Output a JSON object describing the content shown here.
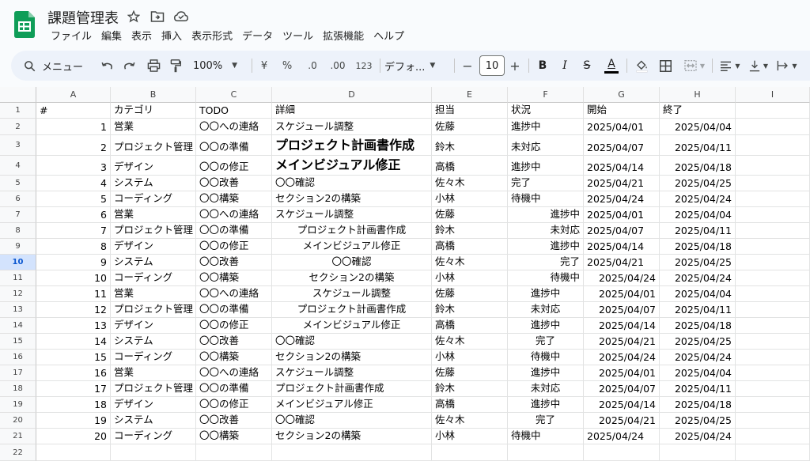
{
  "doc": {
    "title": "課題管理表"
  },
  "menu": [
    "ファイル",
    "編集",
    "表示",
    "挿入",
    "表示形式",
    "データ",
    "ツール",
    "拡張機能",
    "ヘルプ"
  ],
  "toolbar": {
    "search_label": "メニュー",
    "zoom": "100%",
    "currency": "¥",
    "percent": "%",
    "dec_decrease": ".0",
    "dec_increase": ".00",
    "number_format": "123",
    "font": "デフォ...",
    "font_size": "10",
    "minus": "−",
    "plus": "+",
    "bold": "B",
    "italic": "I",
    "strike": "S",
    "textcolor": "A"
  },
  "columns": [
    "A",
    "B",
    "C",
    "D",
    "E",
    "F",
    "G",
    "H",
    "I"
  ],
  "header_row": [
    "#",
    "カテゴリ",
    "TODO",
    "詳細",
    "担当",
    "状況",
    "開始",
    "終了",
    ""
  ],
  "rows": [
    [
      "1",
      "営業",
      "〇〇への連絡",
      "スケジュール調整",
      "佐藤",
      "進捗中",
      "2025/04/01",
      "2025/04/04"
    ],
    [
      "2",
      "プロジェクト管理",
      "〇〇の準備",
      "プロジェクト計画書作成",
      "鈴木",
      "未対応",
      "2025/04/07",
      "2025/04/11"
    ],
    [
      "3",
      "デザイン",
      "〇〇の修正",
      "メインビジュアル修正",
      "高橋",
      "進捗中",
      "2025/04/14",
      "2025/04/18"
    ],
    [
      "4",
      "システム",
      "〇〇改善",
      "〇〇確認",
      "佐々木",
      "完了",
      "2025/04/21",
      "2025/04/25"
    ],
    [
      "5",
      "コーディング",
      "〇〇構築",
      "セクション2の構築",
      "小林",
      "待機中",
      "2025/04/24",
      "2025/04/24"
    ],
    [
      "6",
      "営業",
      "〇〇への連絡",
      "スケジュール調整",
      "佐藤",
      "進捗中",
      "2025/04/01",
      "2025/04/04"
    ],
    [
      "7",
      "プロジェクト管理",
      "〇〇の準備",
      "プロジェクト計画書作成",
      "鈴木",
      "未対応",
      "2025/04/07",
      "2025/04/11"
    ],
    [
      "8",
      "デザイン",
      "〇〇の修正",
      "メインビジュアル修正",
      "高橋",
      "進捗中",
      "2025/04/14",
      "2025/04/18"
    ],
    [
      "9",
      "システム",
      "〇〇改善",
      "〇〇確認",
      "佐々木",
      "完了",
      "2025/04/21",
      "2025/04/25"
    ],
    [
      "10",
      "コーディング",
      "〇〇構築",
      "セクション2の構築",
      "小林",
      "待機中",
      "2025/04/24",
      "2025/04/24"
    ],
    [
      "11",
      "営業",
      "〇〇への連絡",
      "スケジュール調整",
      "佐藤",
      "進捗中",
      "2025/04/01",
      "2025/04/04"
    ],
    [
      "12",
      "プロジェクト管理",
      "〇〇の準備",
      "プロジェクト計画書作成",
      "鈴木",
      "未対応",
      "2025/04/07",
      "2025/04/11"
    ],
    [
      "13",
      "デザイン",
      "〇〇の修正",
      "メインビジュアル修正",
      "高橋",
      "進捗中",
      "2025/04/14",
      "2025/04/18"
    ],
    [
      "14",
      "システム",
      "〇〇改善",
      "〇〇確認",
      "佐々木",
      "完了",
      "2025/04/21",
      "2025/04/25"
    ],
    [
      "15",
      "コーディング",
      "〇〇構築",
      "セクション2の構築",
      "小林",
      "待機中",
      "2025/04/24",
      "2025/04/24"
    ],
    [
      "16",
      "営業",
      "〇〇への連絡",
      "スケジュール調整",
      "佐藤",
      "進捗中",
      "2025/04/01",
      "2025/04/04"
    ],
    [
      "17",
      "プロジェクト管理",
      "〇〇の準備",
      "プロジェクト計画書作成",
      "鈴木",
      "未対応",
      "2025/04/07",
      "2025/04/11"
    ],
    [
      "18",
      "デザイン",
      "〇〇の修正",
      "メインビジュアル修正",
      "高橋",
      "進捗中",
      "2025/04/14",
      "2025/04/18"
    ],
    [
      "19",
      "システム",
      "〇〇改善",
      "〇〇確認",
      "佐々木",
      "完了",
      "2025/04/21",
      "2025/04/25"
    ],
    [
      "20",
      "コーディング",
      "〇〇構築",
      "セクション2の構築",
      "小林",
      "待機中",
      "2025/04/24",
      "2025/04/24"
    ],
    [
      "",
      "",
      "",
      "",
      "",
      "",
      "",
      "",
      ""
    ]
  ],
  "row_numbers": [
    "1",
    "2",
    "3",
    "4",
    "5",
    "6",
    "7",
    "8",
    "9",
    "10",
    "11",
    "12",
    "13",
    "14",
    "15",
    "16",
    "17",
    "18",
    "19",
    "20",
    "21",
    "22"
  ],
  "selected_row": "10",
  "colors": {
    "accent": "#0b57d0",
    "sheets_green": "#0f9d58",
    "toolbar_bg": "#edf2fa"
  }
}
